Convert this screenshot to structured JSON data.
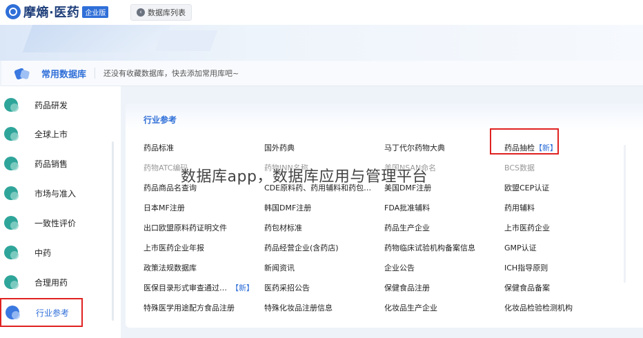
{
  "header": {
    "logo_text": "摩熵·医药",
    "logo_badge": "企业版",
    "db_list_button": "数据库列表"
  },
  "favorites": {
    "title": "常用数据库",
    "note": "还没有收藏数据库，快去添加常用库吧~"
  },
  "sidebar": {
    "items": [
      {
        "label": "药品研发"
      },
      {
        "label": "全球上市"
      },
      {
        "label": "药品销售"
      },
      {
        "label": "市场与准入"
      },
      {
        "label": "一致性评价"
      },
      {
        "label": "中药"
      },
      {
        "label": "合理用药"
      },
      {
        "label": "行业参考"
      }
    ],
    "active_index": 7
  },
  "panel": {
    "title": "行业参考",
    "new_tag": "【新】",
    "rows": [
      [
        "药品标准",
        "国外药典",
        "马丁代尔药物大典",
        "药品抽检"
      ],
      [
        "药物ATC编码",
        "药物INN名称",
        "美国NSAN命名",
        "BCS数据"
      ],
      [
        "药品商品名查询",
        "CDE原料药、药用辅料和药包…",
        "美国DMF注册",
        "欧盟CEP认证"
      ],
      [
        "日本MF注册",
        "韩国DMF注册",
        "FDA批准辅料",
        "药用辅料"
      ],
      [
        "出口欧盟原料药证明文件",
        "药包材标准",
        "药品生产企业",
        "上市医药企业"
      ],
      [
        "上市医药企业年报",
        "药品经营企业(含药店)",
        "药物临床试验机构备案信息",
        "GMP认证"
      ],
      [
        "政策法规数据库",
        "新闻资讯",
        "企业公告",
        "ICH指导原则"
      ],
      [
        "医保目录形式审查通过…",
        "医药采招公告",
        "保健食品注册",
        "保健食品备案"
      ],
      [
        "特殊医学用途配方食品注册",
        "特殊化妆品注册信息",
        "化妆品生产企业",
        "化妆品检验检测机构"
      ]
    ]
  },
  "watermark": "数据库app，数据库应用与管理平台"
}
